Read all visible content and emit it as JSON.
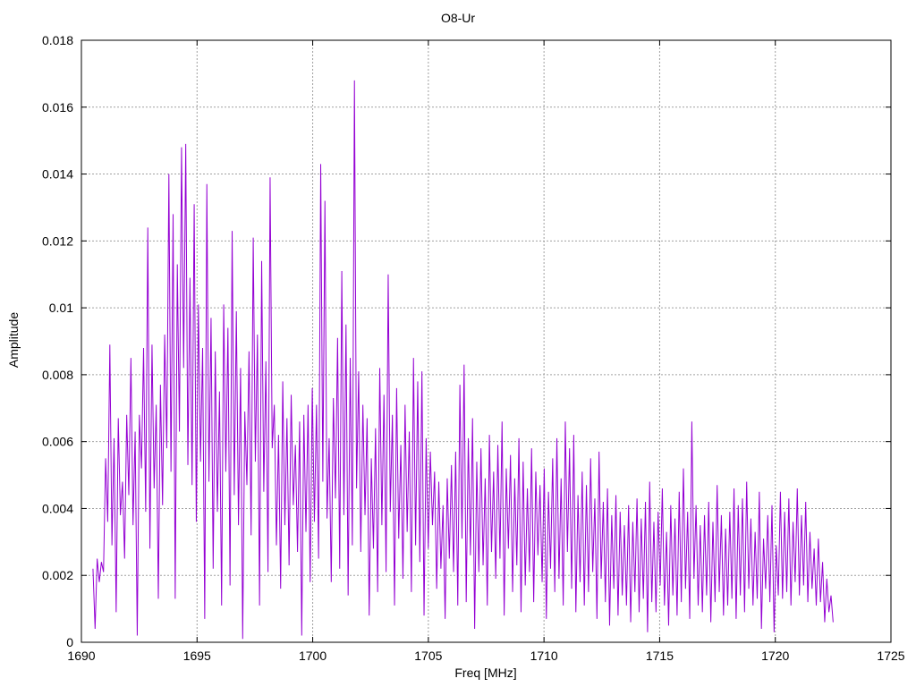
{
  "chart_data": {
    "type": "line",
    "title": "O8-Ur",
    "xlabel": "Freq [MHz]",
    "ylabel": "Amplitude",
    "xlim": [
      1690,
      1725
    ],
    "ylim": [
      0,
      0.018
    ],
    "x_ticks": [
      "1690",
      "1695",
      "1700",
      "1705",
      "1710",
      "1715",
      "1720",
      "1725"
    ],
    "y_ticks": [
      "0",
      "0.002",
      "0.004",
      "0.006",
      "0.008",
      "0.01",
      "0.012",
      "0.014",
      "0.016",
      "0.018"
    ],
    "grid": true,
    "line_color": "#9400d3",
    "series": [
      {
        "x_start": 1690.5,
        "x_end": 1722.5,
        "values": [
          0.0022,
          0.0004,
          0.0025,
          0.0018,
          0.0024,
          0.0021,
          0.0055,
          0.0036,
          0.0089,
          0.0029,
          0.0061,
          0.0009,
          0.0067,
          0.0038,
          0.0048,
          0.0025,
          0.0068,
          0.0044,
          0.0085,
          0.0035,
          0.0063,
          0.0002,
          0.0068,
          0.0052,
          0.0088,
          0.0039,
          0.0124,
          0.0028,
          0.0089,
          0.0046,
          0.0071,
          0.0013,
          0.0077,
          0.0041,
          0.0092,
          0.0058,
          0.014,
          0.0051,
          0.0128,
          0.0013,
          0.0113,
          0.0063,
          0.0148,
          0.0082,
          0.0149,
          0.0053,
          0.0109,
          0.0047,
          0.0131,
          0.0036,
          0.0101,
          0.0054,
          0.0088,
          0.0007,
          0.0137,
          0.0048,
          0.0097,
          0.0022,
          0.0087,
          0.0039,
          0.0075,
          0.0011,
          0.0101,
          0.0051,
          0.0094,
          0.0017,
          0.0123,
          0.0044,
          0.0099,
          0.0035,
          0.0082,
          0.0001,
          0.0069,
          0.0047,
          0.0087,
          0.0032,
          0.0121,
          0.0054,
          0.0092,
          0.0011,
          0.0114,
          0.0045,
          0.0084,
          0.0021,
          0.0139,
          0.0058,
          0.0071,
          0.0029,
          0.0062,
          0.0016,
          0.0078,
          0.0035,
          0.0067,
          0.0023,
          0.0074,
          0.0041,
          0.0059,
          0.0027,
          0.0066,
          0.0002,
          0.0068,
          0.0033,
          0.0071,
          0.0018,
          0.0076,
          0.0036,
          0.0071,
          0.0025,
          0.0143,
          0.0048,
          0.0132,
          0.0037,
          0.0061,
          0.0018,
          0.0073,
          0.0043,
          0.0091,
          0.0022,
          0.0111,
          0.0038,
          0.0095,
          0.0014,
          0.0085,
          0.0029,
          0.0168,
          0.0046,
          0.0081,
          0.0027,
          0.0071,
          0.0038,
          0.0067,
          0.0008,
          0.0055,
          0.0028,
          0.0064,
          0.0015,
          0.0082,
          0.0035,
          0.0074,
          0.0021,
          0.011,
          0.0039,
          0.0068,
          0.0011,
          0.0076,
          0.0031,
          0.0059,
          0.0019,
          0.0071,
          0.0033,
          0.0063,
          0.0015,
          0.0085,
          0.0029,
          0.0078,
          0.0024,
          0.0081,
          0.0008,
          0.0061,
          0.0028,
          0.0057,
          0.0035,
          0.0051,
          0.0016,
          0.0048,
          0.0022,
          0.0041,
          0.0007,
          0.0049,
          0.0025,
          0.0053,
          0.0021,
          0.0057,
          0.0011,
          0.0077,
          0.0031,
          0.0083,
          0.0012,
          0.0061,
          0.0026,
          0.0067,
          0.0004,
          0.0054,
          0.0021,
          0.0058,
          0.0023,
          0.0049,
          0.0011,
          0.0062,
          0.0027,
          0.0051,
          0.0019,
          0.0059,
          0.0025,
          0.0066,
          0.0008,
          0.0052,
          0.0028,
          0.0056,
          0.0015,
          0.0049,
          0.0023,
          0.0061,
          0.0009,
          0.0054,
          0.0017,
          0.0046,
          0.0021,
          0.0058,
          0.0012,
          0.0051,
          0.0026,
          0.0047,
          0.0018,
          0.0052,
          0.0007,
          0.0045,
          0.0022,
          0.0055,
          0.0015,
          0.0061,
          0.0019,
          0.0049,
          0.0011,
          0.0066,
          0.0027,
          0.0058,
          0.0016,
          0.0062,
          0.0009,
          0.0044,
          0.0018,
          0.0051,
          0.0011,
          0.0047,
          0.0015,
          0.0055,
          0.0021,
          0.0043,
          0.0007,
          0.0057,
          0.0019,
          0.0042,
          0.0012,
          0.0046,
          0.0005,
          0.0038,
          0.0016,
          0.0044,
          0.0008,
          0.0039,
          0.0014,
          0.0035,
          0.0011,
          0.0041,
          0.0006,
          0.0036,
          0.0015,
          0.0043,
          0.0009,
          0.0037,
          0.0013,
          0.0042,
          0.0003,
          0.0048,
          0.0012,
          0.0036,
          0.0009,
          0.0039,
          0.0017,
          0.0046,
          0.0011,
          0.0033,
          0.0005,
          0.0041,
          0.0014,
          0.0037,
          0.0008,
          0.0045,
          0.0012,
          0.0052,
          0.0016,
          0.0039,
          0.0007,
          0.0066,
          0.0019,
          0.0041,
          0.0011,
          0.0035,
          0.0009,
          0.0038,
          0.0014,
          0.0042,
          0.0006,
          0.0036,
          0.0012,
          0.0047,
          0.0015,
          0.0038,
          0.0008,
          0.0034,
          0.0011,
          0.0039,
          0.0013,
          0.0046,
          0.0007,
          0.0041,
          0.0014,
          0.0043,
          0.0009,
          0.0048,
          0.0016,
          0.0037,
          0.0011,
          0.0033,
          0.0013,
          0.0045,
          0.0004,
          0.0031,
          0.0016,
          0.0038,
          0.0012,
          0.0041,
          0.0003,
          0.0029,
          0.0014,
          0.0045,
          0.0013,
          0.0039,
          0.0015,
          0.0043,
          0.0011,
          0.0036,
          0.0018,
          0.0046,
          0.0014,
          0.0038,
          0.0017,
          0.0042,
          0.0012,
          0.0033,
          0.0016,
          0.0028,
          0.0011,
          0.0031,
          0.0012,
          0.0024,
          0.0006,
          0.0019,
          0.0009,
          0.0014,
          0.0006
        ]
      }
    ]
  }
}
